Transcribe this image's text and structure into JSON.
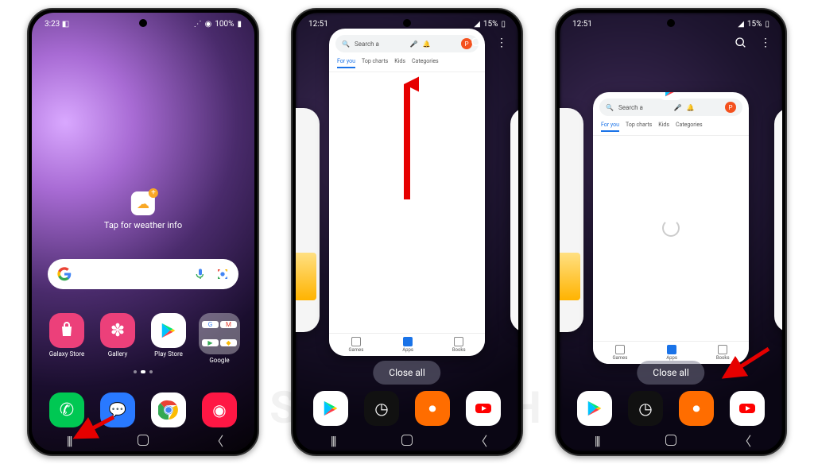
{
  "watermark": "SEBERTECH",
  "phone1": {
    "status": {
      "time": "3:23",
      "extra": "◧",
      "battery": "100%",
      "signal": "◉"
    },
    "weather_label": "Tap for weather info",
    "apps": [
      {
        "name": "Galaxy Store",
        "color": "#e91e63",
        "icon": "bag"
      },
      {
        "name": "Gallery",
        "color": "#e91e63",
        "icon": "flower"
      },
      {
        "name": "Play Store",
        "color": "#ffffff",
        "icon": "play"
      },
      {
        "name": "Google",
        "color": "#ffffff",
        "icon": "gfolder"
      }
    ],
    "dock_icons": [
      "phone",
      "chat",
      "chrome",
      "camera"
    ]
  },
  "phone2": {
    "status": {
      "time": "12:51",
      "battery": "15%"
    },
    "play_search_placeholder": "Search a",
    "play_tabs": [
      "For you",
      "Top charts",
      "Kids",
      "Categories"
    ],
    "play_bottom": [
      {
        "label": "Games",
        "active": false
      },
      {
        "label": "Apps",
        "active": true
      },
      {
        "label": "Books",
        "active": false
      }
    ],
    "close_all": "Close all",
    "dock_icons": [
      "play",
      "speed",
      "rec",
      "youtube"
    ]
  },
  "phone3": {
    "status": {
      "time": "12:51",
      "battery": "15%"
    },
    "play_search_placeholder": "Search a",
    "play_tabs": [
      "For you",
      "Top charts",
      "Kids",
      "Categories"
    ],
    "play_bottom": [
      {
        "label": "Games",
        "active": false
      },
      {
        "label": "Apps",
        "active": true
      },
      {
        "label": "Books",
        "active": false
      }
    ],
    "close_all": "Close all",
    "dock_icons": [
      "play",
      "speed",
      "rec",
      "youtube"
    ]
  }
}
